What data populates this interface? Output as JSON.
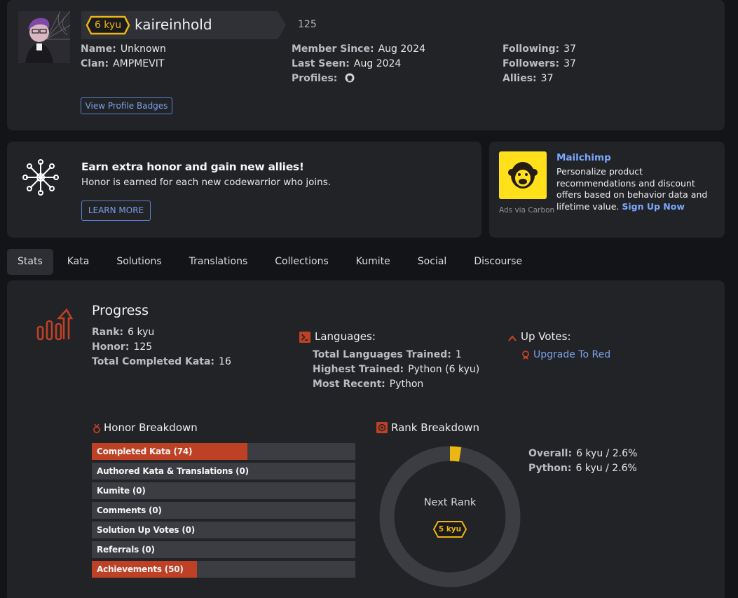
{
  "profile": {
    "rank": "6 kyu",
    "username": "kaireinhold",
    "honor": "125",
    "col1": [
      {
        "label": "Name:",
        "value": "Unknown"
      },
      {
        "label": "Clan:",
        "value": "AMPMEVIT"
      }
    ],
    "col2": [
      {
        "label": "Member Since:",
        "value": "Aug 2024"
      },
      {
        "label": "Last Seen:",
        "value": "Aug 2024"
      },
      {
        "label": "Profiles:",
        "value": ""
      }
    ],
    "col3": [
      {
        "label": "Following:",
        "value": "37"
      },
      {
        "label": "Followers:",
        "value": "37"
      },
      {
        "label": "Allies:",
        "value": "37"
      }
    ],
    "badges_button": "View Profile Badges",
    "profile_icons": [
      "github-icon"
    ]
  },
  "promo": {
    "title": "Earn extra honor and gain new allies!",
    "subtitle": "Honor is earned for each new codewarrior who joins.",
    "button": "LEARN MORE",
    "icon": "network-icon"
  },
  "ad": {
    "title": "Mailchimp",
    "text": "Personalize product recommendations and discount offers based on behavior data and lifetime value.",
    "link": "Sign Up Now",
    "via": "Ads via Carbon",
    "logo": "mailchimp-logo",
    "brand_color": "#ffe01b"
  },
  "tabs": [
    {
      "label": "Stats",
      "active": true
    },
    {
      "label": "Kata",
      "active": false
    },
    {
      "label": "Solutions",
      "active": false
    },
    {
      "label": "Translations",
      "active": false
    },
    {
      "label": "Collections",
      "active": false
    },
    {
      "label": "Kumite",
      "active": false
    },
    {
      "label": "Social",
      "active": false
    },
    {
      "label": "Discourse",
      "active": false
    }
  ],
  "progress": {
    "title": "Progress",
    "items": [
      {
        "label": "Rank:",
        "value": "6 kyu"
      },
      {
        "label": "Honor:",
        "value": "125"
      },
      {
        "label": "Total Completed Kata:",
        "value": "16"
      }
    ]
  },
  "languages": {
    "title": "Languages:",
    "items": [
      {
        "label": "Total Languages Trained:",
        "value": "1"
      },
      {
        "label": "Highest Trained:",
        "value": "Python (6 kyu)"
      },
      {
        "label": "Most Recent:",
        "value": "Python"
      }
    ]
  },
  "upvotes": {
    "title": "Up Votes:",
    "link": "Upgrade To Red"
  },
  "honor_breakdown": {
    "title": "Honor Breakdown",
    "rows": [
      {
        "label": "Completed Kata (74)",
        "fill": 0.59
      },
      {
        "label": "Authored Kata & Translations (0)",
        "fill": 0
      },
      {
        "label": "Kumite (0)",
        "fill": 0
      },
      {
        "label": "Comments (0)",
        "fill": 0
      },
      {
        "label": "Solution Up Votes (0)",
        "fill": 0
      },
      {
        "label": "Referrals (0)",
        "fill": 0
      },
      {
        "label": "Achievements (50)",
        "fill": 0.4
      }
    ]
  },
  "rank_breakdown": {
    "title": "Rank Breakdown",
    "next_rank_label": "Next Rank",
    "next_rank": "5 kyu",
    "progress_fraction": 0.026,
    "items": [
      {
        "label": "Overall:",
        "value": "6 kyu / 2.6%"
      },
      {
        "label": "Python:",
        "value": "6 kyu / 2.6%"
      }
    ]
  },
  "colors": {
    "accent_red": "#be4125",
    "rank_yellow": "#ecb613",
    "link_blue": "#7a9fe8"
  }
}
